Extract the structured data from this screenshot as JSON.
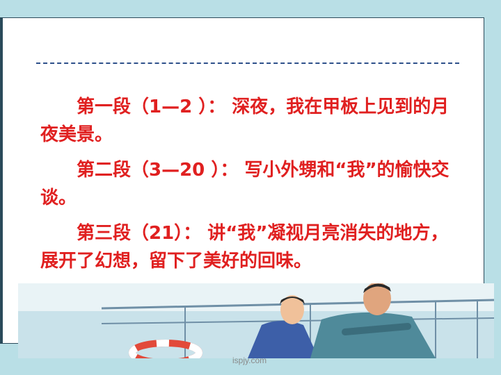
{
  "slide": {
    "paragraphs": [
      "第一段（1—2 ）： 深夜，我在甲板上见到的月夜美景。",
      "第二段（3—20 ）： 写小外甥和“我”的愉快交谈。",
      "第三段（21）： 讲“我”凝视月亮消失的地方， 展开了幻想，留下了美好的回味。"
    ]
  },
  "watermark": "ispjy.com",
  "colors": {
    "text": "#e02020",
    "background": "#b9dfe6",
    "rule": "#2d4f8a"
  }
}
